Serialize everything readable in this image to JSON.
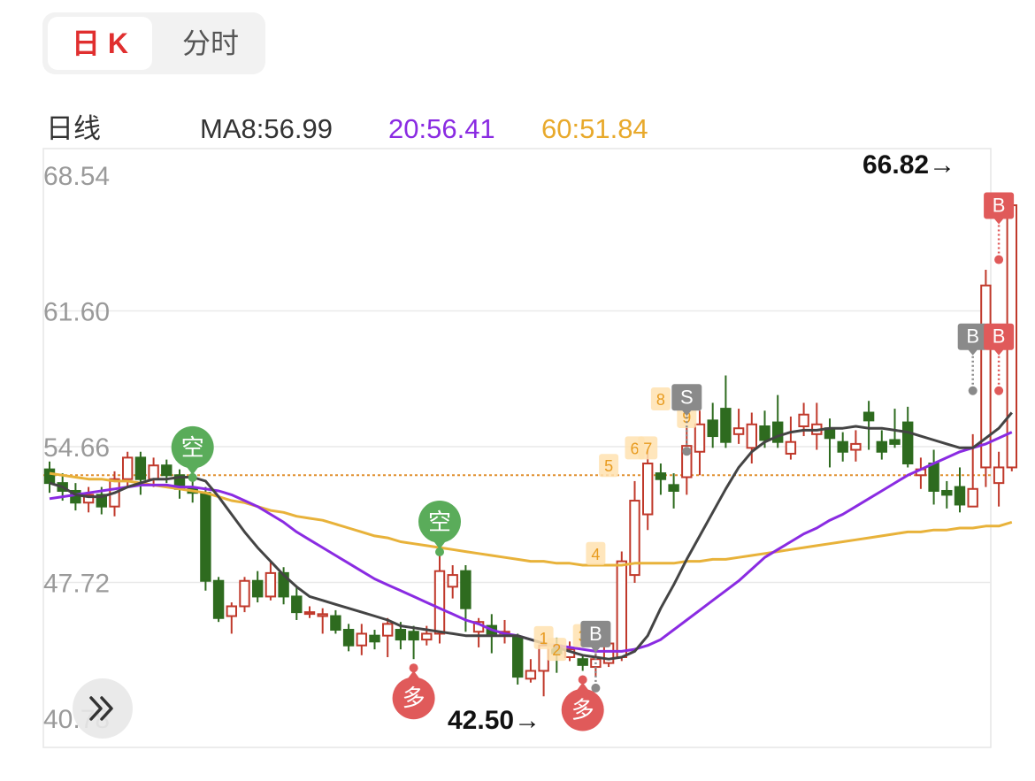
{
  "tabs": [
    {
      "label": "日 K",
      "active": true
    },
    {
      "label": "分时",
      "active": false
    }
  ],
  "legend": {
    "period": "日线",
    "ma8": "MA8:56.99",
    "ma20": "20:56.41",
    "ma60": "60:51.84",
    "colors": {
      "ma8": "#444444",
      "ma20": "#8a2be2",
      "ma60": "#e8b23a"
    }
  },
  "colors": {
    "up": "#c0392b",
    "down": "#2e6b1f",
    "signal_buy": "#e05a5a",
    "signal_sell": "#5aac5a"
  },
  "chart_data": {
    "type": "candlestick",
    "y_ticks": [
      "68.54",
      "61.60",
      "54.66",
      "47.72",
      "40.78"
    ],
    "ylim": [
      40.78,
      68.54
    ],
    "reference_line": 53.2,
    "max_label": "66.82→",
    "min_label": "42.50→",
    "candles": [
      [
        53.5,
        52.8,
        53.9,
        52.3
      ],
      [
        52.8,
        52.4,
        53.3,
        51.9
      ],
      [
        52.4,
        51.8,
        52.8,
        51.4
      ],
      [
        51.8,
        52.2,
        52.6,
        51.3
      ],
      [
        52.2,
        51.6,
        52.6,
        51.2
      ],
      [
        51.6,
        53.0,
        53.4,
        51.1
      ],
      [
        53.0,
        54.1,
        54.4,
        52.6
      ],
      [
        54.1,
        53.0,
        54.4,
        52.2
      ],
      [
        53.0,
        53.7,
        54.1,
        52.6
      ],
      [
        53.7,
        53.2,
        54.0,
        52.8
      ],
      [
        53.2,
        52.5,
        53.5,
        52.0
      ],
      [
        52.5,
        52.3,
        52.9,
        51.8
      ],
      [
        52.3,
        47.8,
        52.6,
        47.3
      ],
      [
        47.8,
        45.9,
        48.0,
        45.7
      ],
      [
        46.0,
        46.5,
        46.7,
        45.1
      ],
      [
        46.5,
        47.8,
        48.0,
        46.2
      ],
      [
        47.8,
        47.0,
        48.3,
        46.7
      ],
      [
        47.0,
        48.2,
        48.8,
        46.8
      ],
      [
        48.2,
        47.0,
        48.5,
        46.6
      ],
      [
        47.0,
        46.2,
        47.5,
        45.8
      ],
      [
        46.2,
        46.2,
        46.5,
        45.9
      ],
      [
        46.0,
        46.1,
        46.4,
        45.1
      ],
      [
        46.0,
        45.3,
        46.3,
        45.1
      ],
      [
        45.3,
        44.5,
        45.6,
        44.2
      ],
      [
        44.5,
        45.1,
        45.6,
        44.0
      ],
      [
        45.0,
        44.7,
        45.3,
        44.3
      ],
      [
        45.0,
        45.6,
        45.9,
        43.9
      ],
      [
        45.3,
        44.8,
        45.7,
        44.3
      ],
      [
        45.2,
        44.8,
        45.5,
        43.8
      ],
      [
        44.8,
        45.1,
        45.5,
        44.5
      ],
      [
        45.1,
        48.3,
        49.1,
        44.6
      ],
      [
        47.5,
        48.1,
        48.6,
        46.9
      ],
      [
        48.3,
        46.4,
        48.6,
        45.2
      ],
      [
        45.2,
        45.7,
        45.9,
        44.4
      ],
      [
        45.5,
        45.1,
        46.1,
        44.1
      ],
      [
        45.2,
        45.2,
        45.8,
        44.6
      ],
      [
        44.9,
        42.9,
        45.1,
        42.5
      ],
      [
        42.8,
        43.2,
        43.8,
        42.6
      ],
      [
        43.2,
        44.5,
        45.0,
        41.9
      ],
      [
        44.5,
        44.1,
        44.9,
        43.1
      ],
      [
        43.9,
        44.3,
        44.7,
        43.7
      ],
      [
        43.8,
        43.5,
        44.0,
        43.2
      ],
      [
        43.4,
        43.8,
        44.1,
        42.9
      ],
      [
        43.6,
        44.6,
        45.1,
        43.4
      ],
      [
        43.9,
        48.8,
        49.3,
        43.7
      ],
      [
        48.1,
        51.9,
        52.9,
        47.7
      ],
      [
        51.2,
        53.8,
        54.5,
        50.4
      ],
      [
        53.3,
        53.0,
        53.8,
        52.2
      ],
      [
        52.7,
        52.4,
        53.3,
        51.5
      ],
      [
        53.1,
        54.7,
        55.7,
        52.2
      ],
      [
        54.4,
        55.8,
        56.5,
        53.2
      ],
      [
        56.0,
        55.2,
        56.9,
        54.6
      ],
      [
        56.6,
        54.9,
        58.3,
        54.6
      ],
      [
        55.3,
        55.6,
        56.6,
        54.8
      ],
      [
        54.6,
        55.8,
        56.4,
        53.8
      ],
      [
        55.7,
        55.0,
        56.5,
        54.6
      ],
      [
        55.9,
        54.9,
        57.3,
        54.6
      ],
      [
        54.3,
        54.9,
        56.2,
        54.0
      ],
      [
        55.7,
        56.3,
        56.9,
        55.2
      ],
      [
        55.3,
        55.8,
        56.9,
        54.5
      ],
      [
        55.6,
        55.1,
        56.1,
        53.6
      ],
      [
        54.9,
        54.4,
        55.4,
        53.9
      ],
      [
        54.5,
        54.8,
        55.5,
        53.9
      ],
      [
        56.4,
        56.0,
        57.0,
        54.5
      ],
      [
        54.9,
        54.4,
        55.5,
        54.0
      ],
      [
        55.0,
        54.8,
        56.6,
        54.6
      ],
      [
        55.9,
        53.8,
        56.7,
        53.6
      ],
      [
        53.2,
        53.5,
        54.1,
        52.5
      ],
      [
        53.8,
        52.4,
        54.5,
        51.7
      ],
      [
        52.4,
        52.2,
        52.9,
        51.5
      ],
      [
        52.6,
        51.7,
        53.6,
        51.3
      ],
      [
        51.6,
        52.5,
        55.3,
        52.1
      ],
      [
        53.6,
        62.9,
        63.7,
        52.6
      ],
      [
        52.8,
        53.6,
        54.4,
        51.6
      ],
      [
        53.6,
        67.0,
        67.0,
        53.4
      ]
    ],
    "ma8": [
      52.8,
      52.6,
      52.2,
      52.1,
      52.1,
      52.3,
      52.6,
      52.8,
      53.0,
      53.0,
      53.1,
      53.1,
      52.9,
      52.1,
      51.2,
      50.3,
      49.5,
      48.8,
      48.1,
      47.5,
      47.0,
      46.8,
      46.6,
      46.4,
      46.2,
      46.0,
      45.8,
      45.5,
      45.4,
      45.3,
      45.2,
      45.1,
      45.0,
      45.0,
      45.0,
      45.0,
      45.0,
      44.8,
      44.6,
      44.4,
      44.2,
      44.0,
      43.9,
      43.8,
      43.9,
      44.2,
      45.0,
      46.4,
      47.6,
      48.9,
      50.1,
      51.3,
      52.5,
      53.6,
      54.4,
      54.9,
      55.2,
      55.4,
      55.5,
      55.5,
      55.6,
      55.6,
      55.7,
      55.6,
      55.6,
      55.5,
      55.4,
      55.2,
      55.0,
      54.8,
      54.6,
      54.6,
      55.1,
      55.6,
      56.4
    ],
    "ma20": [
      52.0,
      52.1,
      52.2,
      52.3,
      52.4,
      52.5,
      52.6,
      52.7,
      52.7,
      52.7,
      52.6,
      52.6,
      52.5,
      52.4,
      52.2,
      51.9,
      51.6,
      51.2,
      50.8,
      50.3,
      49.9,
      49.5,
      49.1,
      48.7,
      48.3,
      47.9,
      47.6,
      47.3,
      47.0,
      46.7,
      46.4,
      46.1,
      45.8,
      45.6,
      45.3,
      45.1,
      45.0,
      44.8,
      44.6,
      44.5,
      44.4,
      44.3,
      44.2,
      44.2,
      44.2,
      44.3,
      44.5,
      44.8,
      45.3,
      45.8,
      46.3,
      46.8,
      47.3,
      47.8,
      48.4,
      49.0,
      49.4,
      49.8,
      50.2,
      50.5,
      50.9,
      51.2,
      51.6,
      52.0,
      52.4,
      52.8,
      53.2,
      53.5,
      53.8,
      54.1,
      54.4,
      54.6,
      54.8,
      55.1,
      55.4
    ],
    "ma60": [
      53.3,
      53.2,
      53.1,
      53.0,
      53.0,
      52.9,
      52.9,
      52.8,
      52.7,
      52.6,
      52.5,
      52.4,
      52.3,
      52.1,
      51.9,
      51.8,
      51.6,
      51.4,
      51.3,
      51.1,
      51.0,
      50.9,
      50.7,
      50.5,
      50.3,
      50.1,
      50.0,
      49.8,
      49.7,
      49.6,
      49.5,
      49.4,
      49.3,
      49.2,
      49.1,
      49.0,
      48.9,
      48.8,
      48.8,
      48.7,
      48.7,
      48.6,
      48.6,
      48.6,
      48.6,
      48.7,
      48.7,
      48.7,
      48.7,
      48.8,
      48.8,
      48.9,
      48.9,
      49.0,
      49.1,
      49.2,
      49.3,
      49.4,
      49.5,
      49.6,
      49.7,
      49.8,
      49.9,
      50.0,
      50.1,
      50.2,
      50.3,
      50.3,
      50.4,
      50.4,
      50.5,
      50.5,
      50.6,
      50.6,
      50.8
    ],
    "signals": [
      {
        "label": "空",
        "kind": "sell",
        "index": 11
      },
      {
        "label": "空",
        "kind": "sell",
        "index": 30
      },
      {
        "label": "多",
        "kind": "buy",
        "index": 28
      },
      {
        "label": "多",
        "kind": "buy",
        "index": 41
      }
    ],
    "markers": [
      {
        "label": "B",
        "kind": "red",
        "index": 73,
        "price": 66.3
      },
      {
        "label": "B",
        "kind": "gray",
        "index": 71,
        "price": 59.6
      },
      {
        "label": "B",
        "kind": "red",
        "index": 73,
        "price": 59.6
      },
      {
        "label": "S",
        "kind": "gray",
        "index": 49,
        "price": 56.5
      },
      {
        "label": "B",
        "kind": "gray",
        "index": 42,
        "price": 44.4
      }
    ],
    "countdown": [
      {
        "label": "1",
        "index": 38,
        "price": 44.9
      },
      {
        "label": "2",
        "index": 39,
        "price": 44.3
      },
      {
        "label": "3",
        "index": 41,
        "price": 45.0
      },
      {
        "label": "4",
        "index": 42,
        "price": 49.2
      },
      {
        "label": "5",
        "index": 43,
        "price": 53.7
      },
      {
        "label": "6",
        "index": 45,
        "price": 54.6
      },
      {
        "label": "7",
        "index": 46,
        "price": 54.6
      },
      {
        "label": "8",
        "index": 47,
        "price": 57.1
      },
      {
        "label": "9",
        "index": 49,
        "price": 56.2
      }
    ]
  }
}
